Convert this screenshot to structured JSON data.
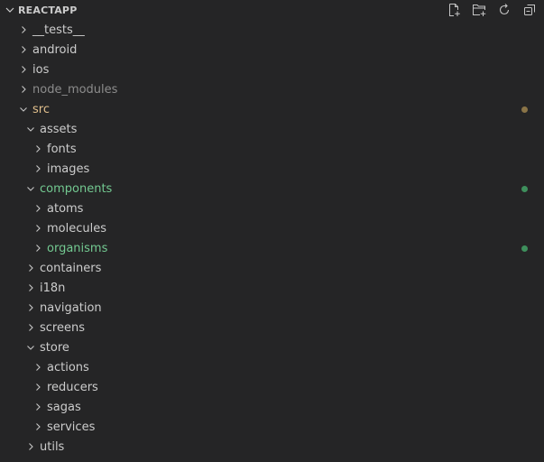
{
  "explorer": {
    "title": "REACTAPP",
    "actions": [
      {
        "name": "new-file-icon"
      },
      {
        "name": "new-folder-icon"
      },
      {
        "name": "refresh-icon"
      },
      {
        "name": "collapse-all-icon"
      }
    ]
  },
  "colors": {
    "default_text": "#cccccc",
    "ignored_text": "#8c8c8c",
    "modified_text": "#e2c08d",
    "untracked_text": "#73c991",
    "modified_dot": "#8a7447",
    "untracked_dot": "#3e8f5c"
  },
  "tree": [
    {
      "label": "__tests__",
      "depth": 0,
      "expanded": false,
      "status": ""
    },
    {
      "label": "android",
      "depth": 0,
      "expanded": false,
      "status": ""
    },
    {
      "label": "ios",
      "depth": 0,
      "expanded": false,
      "status": ""
    },
    {
      "label": "node_modules",
      "depth": 0,
      "expanded": false,
      "status": "ignored"
    },
    {
      "label": "src",
      "depth": 0,
      "expanded": true,
      "status": "modified",
      "dot": true
    },
    {
      "label": "assets",
      "depth": 1,
      "expanded": true,
      "status": ""
    },
    {
      "label": "fonts",
      "depth": 2,
      "expanded": false,
      "status": ""
    },
    {
      "label": "images",
      "depth": 2,
      "expanded": false,
      "status": ""
    },
    {
      "label": "components",
      "depth": 1,
      "expanded": true,
      "status": "untracked",
      "dot": true
    },
    {
      "label": "atoms",
      "depth": 2,
      "expanded": false,
      "status": ""
    },
    {
      "label": "molecules",
      "depth": 2,
      "expanded": false,
      "status": ""
    },
    {
      "label": "organisms",
      "depth": 2,
      "expanded": false,
      "status": "untracked",
      "dot": true
    },
    {
      "label": "containers",
      "depth": 1,
      "expanded": false,
      "status": ""
    },
    {
      "label": "i18n",
      "depth": 1,
      "expanded": false,
      "status": ""
    },
    {
      "label": "navigation",
      "depth": 1,
      "expanded": false,
      "status": ""
    },
    {
      "label": "screens",
      "depth": 1,
      "expanded": false,
      "status": ""
    },
    {
      "label": "store",
      "depth": 1,
      "expanded": true,
      "status": ""
    },
    {
      "label": "actions",
      "depth": 2,
      "expanded": false,
      "status": ""
    },
    {
      "label": "reducers",
      "depth": 2,
      "expanded": false,
      "status": ""
    },
    {
      "label": "sagas",
      "depth": 2,
      "expanded": false,
      "status": ""
    },
    {
      "label": "services",
      "depth": 2,
      "expanded": false,
      "status": ""
    },
    {
      "label": "utils",
      "depth": 1,
      "expanded": false,
      "status": ""
    }
  ]
}
